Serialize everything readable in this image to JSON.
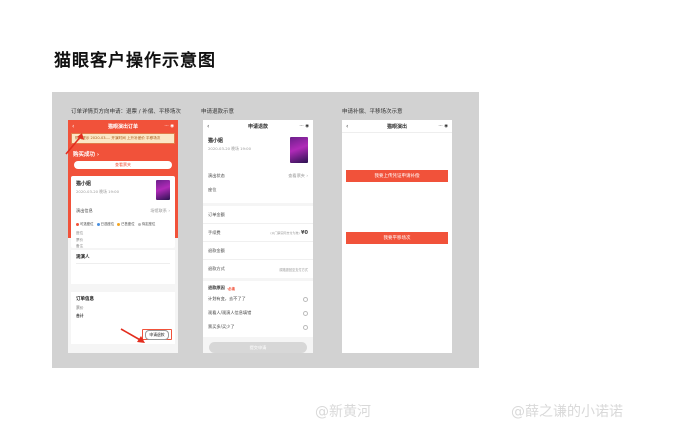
{
  "title": "猫眼客户操作示意图",
  "captions": {
    "p1": "订单详情页方向申请：退票 / 补偿、平移场次",
    "p2": "申请退款示意",
    "p3": "申请补偿、平移场次示意"
  },
  "phone1": {
    "header_title": "猫眼演出订单",
    "notice": "购买提示 2020-03-... 开演时间 上升补差价 平移场次",
    "status": "购买成功 ›",
    "action_btn": "查看票夹",
    "show_name": "猫小姐",
    "show_time": "2020-03-20 晚场 19:00",
    "row_seat": "演出信息",
    "row_seat_value": "场馆联系 ›",
    "legend": [
      "可选座位",
      "已选座位",
      "已售座位",
      "待定座位"
    ],
    "info_lines": [
      "座位",
      "票价",
      "备注"
    ],
    "buyer_label": "观演人",
    "order_label": "订单信息",
    "order_lines": [
      "票价",
      "合计"
    ],
    "apply_btn": "申请退款"
  },
  "phone2": {
    "header_title": "申请退款",
    "show_name": "猫小姐",
    "show_time": "2020-03-20 晚场 19:00",
    "r1": "演出状态",
    "r1v": "查看票夹 ›",
    "r2": "座位",
    "s1": "订单金额",
    "s2": "手续费",
    "s2v": "(以门票实际支付为准)",
    "s2a": "¥0",
    "s3": "退款金额",
    "s4": "退款方式",
    "s4v": "原路退回至支付方式",
    "reason_label": "退款原因",
    "reason_req": "·必填",
    "reasons": [
      "计划有变，去不了了",
      "观看人/观演人信息填错",
      "票买多/买少了"
    ],
    "submit": "提交申请"
  },
  "phone3": {
    "header_title": "猫眼演出",
    "btn1": "我要上传凭证申请补偿",
    "btn2": "我要平移场次"
  },
  "watermark": {
    "w1": "@新黄河",
    "w2": "@薛之谦的小诺诺"
  }
}
